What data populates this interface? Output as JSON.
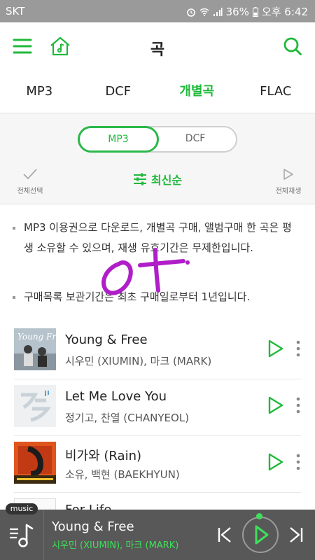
{
  "status_bar": {
    "carrier": "SKT",
    "battery": "36%",
    "time": "오후 6:42"
  },
  "header": {
    "title": "곡"
  },
  "tabs": [
    {
      "label": "MP3",
      "active": false
    },
    {
      "label": "DCF",
      "active": false
    },
    {
      "label": "개별곡",
      "active": true
    },
    {
      "label": "FLAC",
      "active": false
    }
  ],
  "segment": {
    "left": "MP3",
    "right": "DCF",
    "selected": "MP3"
  },
  "toolbar": {
    "select_all": "전체선택",
    "sort": "최신순",
    "play_all": "전체재생"
  },
  "notices": [
    "MP3 이용권으로 다운로드, 개별곡 구매, 앨범구매 한 곡은 평생 소유할 수 있으며, 재생 유효기간은 무제한입니다.",
    "구매목록 보관기간은 최초 구매일로부터 1년입니다."
  ],
  "songs": [
    {
      "title": "Young & Free",
      "artist": "시우민 (XIUMIN), 마크 (MARK)"
    },
    {
      "title": "Let Me Love You",
      "artist": "정기고, 찬열 (CHANYEOL)"
    },
    {
      "title": "비가와 (Rain)",
      "artist": "소유, 백현 (BAEKHYUN)"
    },
    {
      "title": "For Life",
      "artist": ""
    }
  ],
  "album_art_text": {
    "song1": "Young Free"
  },
  "player": {
    "badge": "music",
    "now_playing_title": "Young & Free",
    "now_playing_artist": "시우민 (XIUMIN), 마크 (MARK)"
  },
  "colors": {
    "accent": "#1fb93a",
    "player_bg": "#585858",
    "status_bar": "#9a9a9a",
    "scribble": "#b01ec8"
  },
  "icons": [
    "menu-icon",
    "home-music-icon",
    "search-icon",
    "check-icon",
    "sort-sliders-icon",
    "play-outline-icon",
    "more-vertical-icon",
    "music-note-icon",
    "prev-icon",
    "play-icon",
    "next-icon"
  ]
}
